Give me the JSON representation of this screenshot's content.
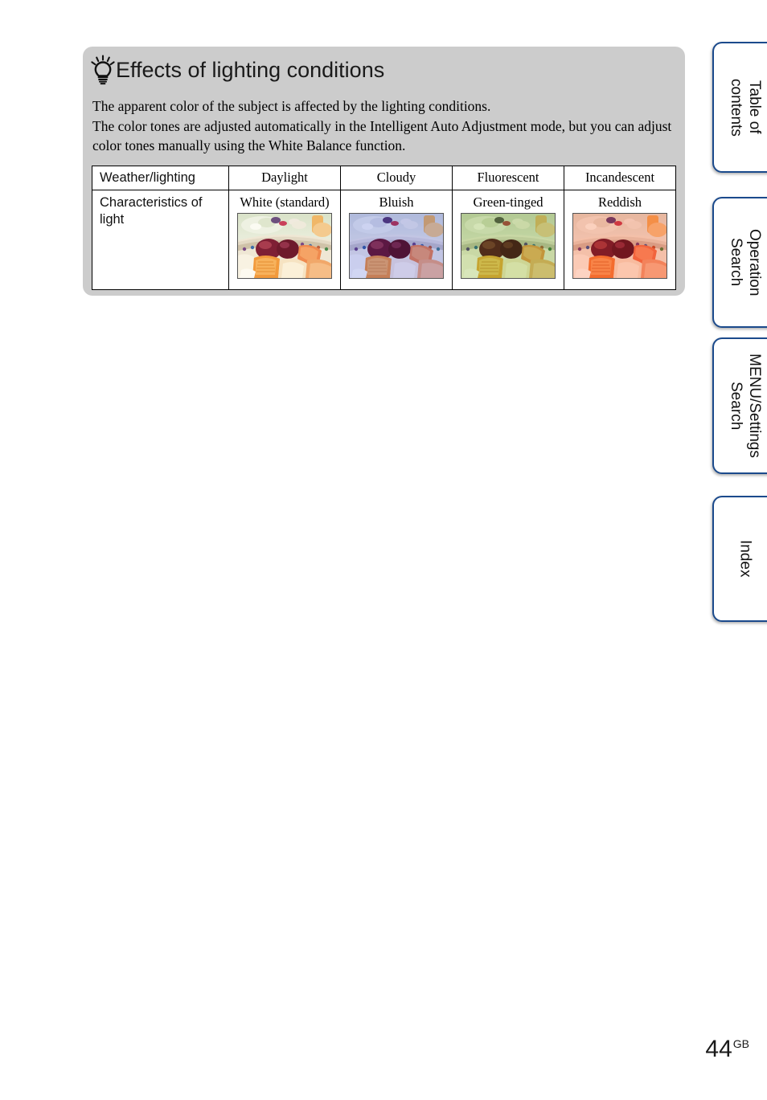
{
  "tip": {
    "icon": "lightbulb-icon",
    "heading": "Effects of lighting conditions",
    "paragraphs": [
      "The apparent color of the subject is affected by the lighting conditions.",
      "The color tones are adjusted automatically in the Intelligent Auto Adjustment mode, but you can adjust color tones manually using the White Balance function."
    ],
    "panel_color": "#cccccc"
  },
  "table": {
    "header": {
      "row_label": "Weather/lighting",
      "conditions": [
        "Daylight",
        "Cloudy",
        "Fluorescent",
        "Incandescent"
      ]
    },
    "rows": [
      {
        "label": "Characteristics of light",
        "cells": [
          {
            "description": "White (standard)",
            "image": "fruit-bowl-photo-daylight"
          },
          {
            "description": "Bluish",
            "image": "fruit-bowl-photo-cloudy"
          },
          {
            "description": "Green-tinged",
            "image": "fruit-bowl-photo-fluorescent"
          },
          {
            "description": "Reddish",
            "image": "fruit-bowl-photo-incandescent"
          }
        ]
      }
    ]
  },
  "side_tabs": [
    {
      "label": "Table of\ncontents",
      "name": "table-of-contents"
    },
    {
      "label": "Operation\nSearch",
      "name": "operation-search"
    },
    {
      "label": "MENU/Settings\nSearch",
      "name": "menu-settings-search"
    },
    {
      "label": "Index",
      "name": "index"
    }
  ],
  "footer": {
    "page_number": "44",
    "page_suffix": "GB"
  },
  "colors": {
    "tab_border": "#1b4a8c",
    "panel_gray": "#cccccc",
    "text": "#000000"
  }
}
